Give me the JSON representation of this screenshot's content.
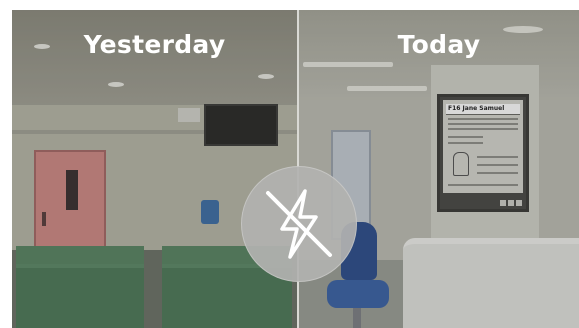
{
  "comparison": {
    "left_label": "Yesterday",
    "right_label": "Today"
  },
  "display": {
    "header_text": "F16 Jane Samuel"
  },
  "icons": {
    "center": "no-power-icon"
  },
  "colors": {
    "label": "#ffffff",
    "badge": "#b2b2b0",
    "divider": "#d9d9d4"
  }
}
